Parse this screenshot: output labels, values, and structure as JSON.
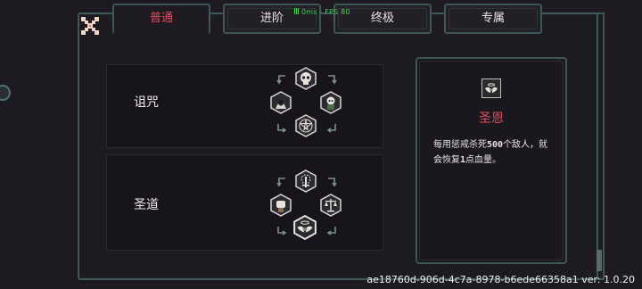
{
  "tabs": [
    {
      "label": "普通",
      "active": true
    },
    {
      "label": "进阶",
      "active": false
    },
    {
      "label": "终极",
      "active": false
    },
    {
      "label": "专属",
      "active": false
    }
  ],
  "fps_overlay": "0ms - FPS 80",
  "rows": [
    {
      "label": "诅咒",
      "icons": [
        "skull-icon",
        "hooded-figure-icon",
        "ghoul-icon",
        "pentagram-icon"
      ]
    },
    {
      "label": "圣道",
      "icons": [
        "radiant-sword-icon",
        "raised-fist-icon",
        "scales-icon",
        "winged-halo-icon"
      ]
    }
  ],
  "detail": {
    "icon": "winged-halo-icon",
    "title": "圣恩",
    "desc_prefix": "每用惩戒杀死",
    "desc_num1": "500",
    "desc_mid": "个敌人，就会恢复",
    "desc_num2": "1",
    "desc_suffix": "点血量。"
  },
  "version": "ae18760d-906d-4c7a-8978-b6ede66358a1 ver: 1.0.20",
  "colors": {
    "accent": "#e14c5e",
    "frame": "#3f5656",
    "background": "#1d1a21",
    "fps": "#3ed44e"
  }
}
